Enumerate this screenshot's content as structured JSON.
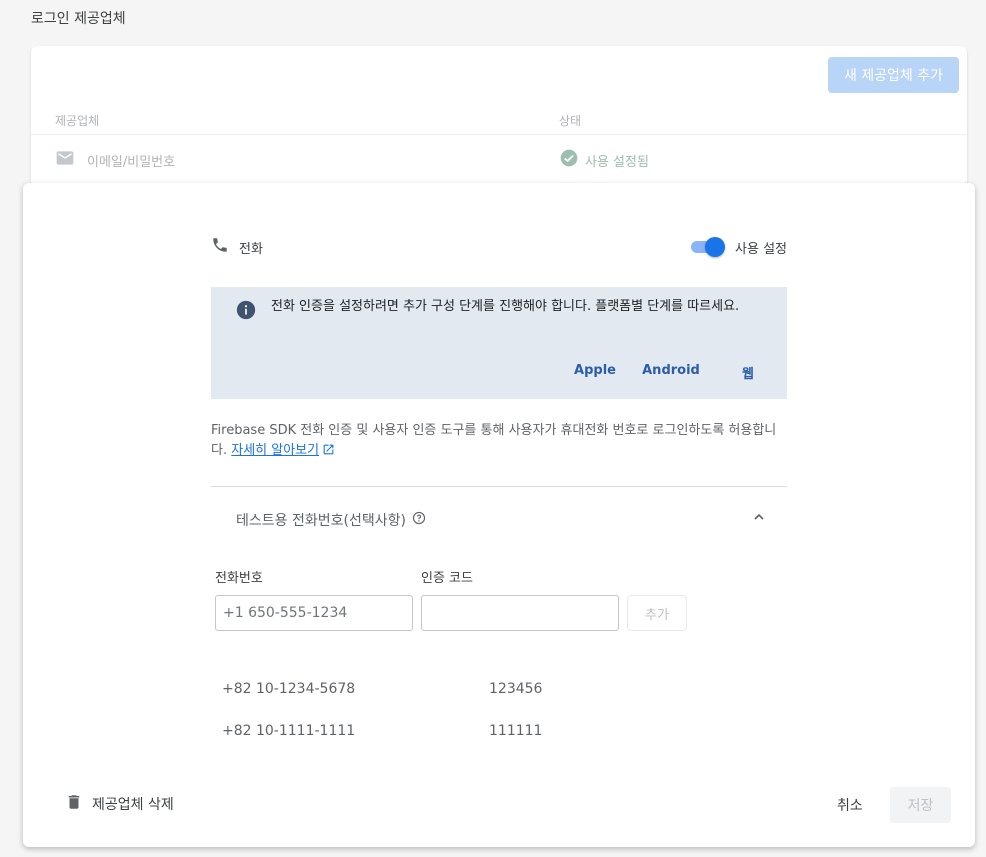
{
  "page": {
    "section_title": "로그인 제공업체"
  },
  "providers_table": {
    "add_provider_label": "새 제공업체 추가",
    "columns": [
      "제공업체",
      "상태"
    ],
    "rows": [
      {
        "provider_icon": "email-icon",
        "provider": "이메일/비밀번호",
        "status_icon": "check-circle-icon",
        "status": "사용 설정됨"
      }
    ]
  },
  "panel": {
    "provider_icon": "phone-icon",
    "provider_name": "전화",
    "toggle_label": "사용 설정",
    "toggle_on": true,
    "info": {
      "icon": "info-icon",
      "text": "전화 인증을 설정하려면 추가 구성 단계를 진행해야 합니다. 플랫폼별 단계를 따르세요.",
      "links": [
        "Apple",
        "Android",
        "웹"
      ]
    },
    "description": "Firebase SDK 전화 인증 및 사용자 인증 도구를 통해 사용자가 휴대전화 번호로 로그인하도록 허용합니다.",
    "learn_more": "자세히 알아보기",
    "test_numbers": {
      "title": "테스트용 전화번호(선택사항)",
      "expanded": true,
      "phone_label": "전화번호",
      "code_label": "인증 코드",
      "phone_placeholder": "+1 650-555-1234",
      "code_value": "",
      "add_label": "추가",
      "entries": [
        {
          "phone": "+82 10-1234-5678",
          "code": "123456"
        },
        {
          "phone": "+82 10-1111-1111",
          "code": "111111"
        }
      ]
    },
    "delete_label": "제공업체 삭제",
    "cancel_label": "취소",
    "save_label": "저장"
  },
  "colors": {
    "primary": "#1a73e8",
    "info_bg": "#e3e9f1",
    "link": "#2c5da8",
    "success": "#9ebfad"
  }
}
